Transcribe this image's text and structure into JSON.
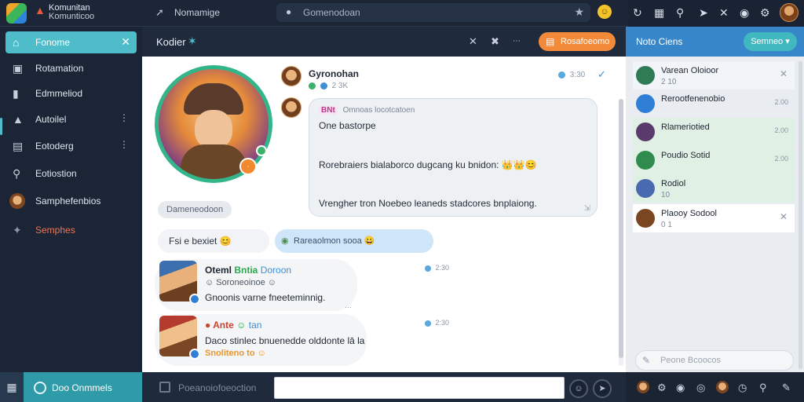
{
  "app": {
    "title": "Komunitan",
    "subtitle": "Komunticoo"
  },
  "topbar": {
    "nav_label": "Nomamige",
    "search_placeholder": "Gomenodoan",
    "icons": [
      "refresh-icon",
      "gift-icon",
      "search-icon",
      "rocket-icon",
      "tools-icon",
      "target-icon",
      "gear-icon"
    ]
  },
  "sidebar": {
    "items": [
      {
        "label": "Fonome",
        "icon": "home-icon"
      },
      {
        "label": "Rotamation",
        "icon": "chat-icon"
      },
      {
        "label": "Edmmeliod",
        "icon": "lock-icon"
      },
      {
        "label": "Autoilel",
        "icon": "bell-icon"
      },
      {
        "label": "Eotoderg",
        "icon": "briefcase-icon"
      },
      {
        "label": "Eotiostion",
        "icon": "search-icon"
      },
      {
        "label": "Samphefenbios",
        "icon": "avatar"
      },
      {
        "label": "Semphes",
        "icon": "sparkle-icon"
      }
    ]
  },
  "bottom_left": {
    "label": "Doo Onmmels"
  },
  "chat_header": {
    "title": "Kodier",
    "action_label": "Rosafoeomo"
  },
  "chat": {
    "hero_badge": "·",
    "gray_pill": "Dameneodoon",
    "header_msg": {
      "name": "Gyronohan",
      "meta": "2 3K",
      "time": "3:30"
    },
    "bubble": {
      "tag": "BNt",
      "header": "Omnoas locotcatoen",
      "line1": "One bastorpe",
      "line2": "Rorebraiers bialaborco dugcang ku bnidon:",
      "line2_emoji": "👑👑😊",
      "line3": "Vrengher tron Noebeo leaneds stadcores bnplaiong."
    },
    "reply_left": {
      "text": "Fsi e bexiet",
      "emoji": "😊"
    },
    "reply_right": {
      "text": "Rareaolmon sooa",
      "emoji": "😀"
    },
    "card1": {
      "name": "Oteml",
      "tag": "Bntia",
      "tag2": "Doroon",
      "line1": "Soroneoinoe",
      "line2": "Gnoonis varne fneeteminnig.",
      "time": "2:30"
    },
    "card2": {
      "name": "Ante",
      "tag2": "tan",
      "line1": "Daco stinlec bnuenedde olddonte lā la",
      "line2": "Snoliteno to",
      "time": "2:30"
    }
  },
  "composer": {
    "placeholder": "Poeanoiofoeoction",
    "value": ""
  },
  "right_panel": {
    "title": "Noto Ciens",
    "button_label": "Semneo",
    "contacts": [
      {
        "name": "Varean Oloioor",
        "sub": "2 10",
        "right": "",
        "color": "#2f7b54"
      },
      {
        "name": "Rerootfenenobio",
        "sub": "",
        "right": "2.00",
        "color": "#2f7fd6"
      },
      {
        "name": "Rlameriotied",
        "sub": "",
        "right": "2.00",
        "color": "#5a3a6a"
      },
      {
        "name": "Poudio Sotid",
        "sub": "",
        "right": "2.00",
        "color": "#2f8b4e"
      },
      {
        "name": "Rodiol",
        "sub": "10",
        "right": "",
        "color": "#4a6ab0"
      },
      {
        "name": "Plaooy Sodool",
        "sub": "0 1",
        "right": "",
        "color": "#7a4621"
      }
    ],
    "search_placeholder": "Peone Bcoocos"
  },
  "colors": {
    "accent_teal": "#4fbcc9",
    "accent_orange": "#f28a3a",
    "panel_blue": "#3786c9",
    "sidebar_dark": "#1b2535"
  }
}
